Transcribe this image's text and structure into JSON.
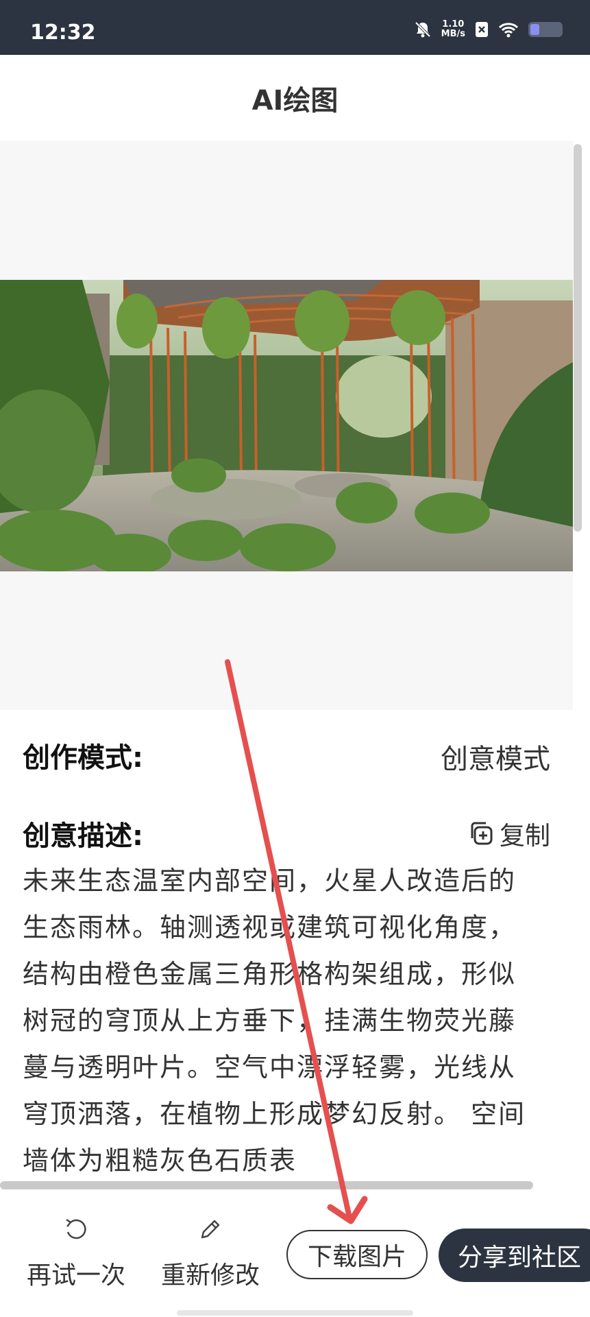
{
  "status_bar": {
    "time": "12:32",
    "net_speed_value": "1.10",
    "net_speed_unit": "MB/s",
    "icons": [
      "bell-muted-icon",
      "sim-x-icon",
      "wifi-icon",
      "battery-icon"
    ],
    "battery_level": 0.3
  },
  "header": {
    "title": "AI绘图"
  },
  "image": {
    "description_icon": "generated-garden-image"
  },
  "details": {
    "mode_label": "创作模式:",
    "mode_value": "创意模式",
    "desc_label": "创意描述:",
    "copy_label": "复制",
    "description": "未来生态温室内部空间，火星人改造后的生态雨林。轴测透视或建筑可视化角度，结构由橙色金属三角形格构架组成，形似树冠的穹顶从上方垂下，挂满生物荧光藤蔓与透明叶片。空气中漂浮轻雾，光线从穹顶洒落，在植物上形成梦幻反射。 空间墙体为粗糙灰色石质表"
  },
  "bottom_bar": {
    "retry_label": "再试一次",
    "edit_label": "重新修改",
    "download_label": "下载图片",
    "share_label": "分享到社区"
  },
  "colors": {
    "status_bar_bg": "#2b3440",
    "share_button_bg": "#2b3440",
    "annotation_arrow": "#e5504f"
  }
}
